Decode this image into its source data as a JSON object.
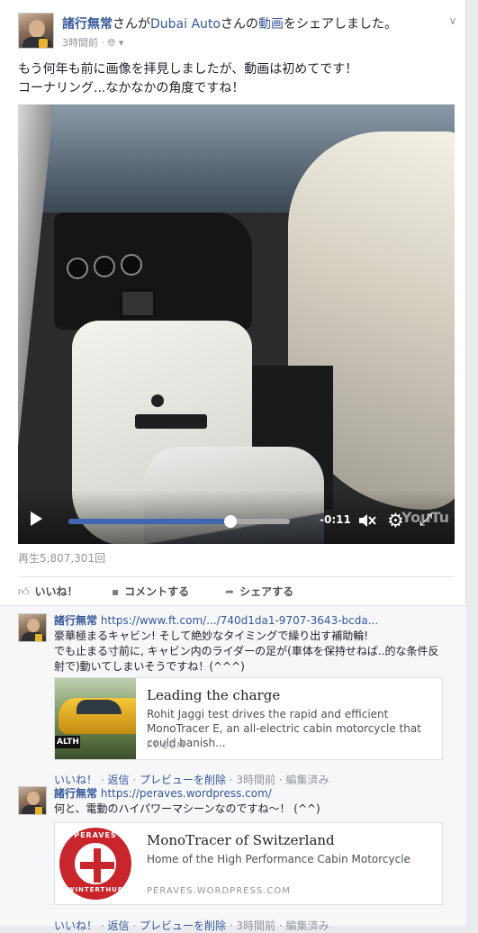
{
  "post": {
    "author": "諸行無常",
    "shared_text_1": "さんが",
    "page_name": "Dubai Auto",
    "shared_text_2": "さんの",
    "video_word": "動画",
    "shared_text_3": "をシェアしました。",
    "time": "3時間前",
    "privacy_icon": "globe-icon",
    "menu_icon": "chevron-down-icon",
    "text_line1": "もう何年も前に画像を拝見しましたが、動画は初めてです！",
    "text_line2": "コーナリング...なかなかの角度ですね！"
  },
  "video": {
    "time_remaining": "-0:11",
    "progress": 0.73,
    "watermark": "YouTu",
    "progress_color": "#4267b2"
  },
  "views": "再生5,807,301回",
  "actions": {
    "like": "いいね！",
    "comment": "コメントする",
    "share": "シェアする"
  },
  "comments": [
    {
      "name": "諸行無常",
      "url": "https://www.ft.com/.../740d1da1-9707-3643-bcda...",
      "text_line1": "豪華極まるキャビン! そして絶妙なタイミングで繰り出す補助輪!",
      "text_line2": "でも止まる寸前に, キャビン内のライダーの足が(車体を保持せねば..的な条件反",
      "text_line3": "射で)動いてしまいそうですね！(^^^)",
      "preview": {
        "title": "Leading the charge",
        "desc": "Rohit Jaggi test drives the rapid and efficient MonoTracer E, an all-electric cabin motorcycle that could banish...",
        "domain": "FT.COM",
        "thumb_label": "ALTH"
      },
      "meta": {
        "like": "いいね！",
        "reply": "返信",
        "remove_preview": "プレビューを削除",
        "time": "3時間前",
        "edited": "編集済み"
      }
    },
    {
      "name": "諸行無常",
      "url": "https://peraves.wordpress.com/",
      "text_line1": "何と、電動のハイパワーマシーンなのですね〜！ (^^)",
      "preview": {
        "title": "MonoTracer of Switzerland",
        "desc": "Home of the High Performance Cabin Motorcycle",
        "domain": "PERAVES.WORDPRESS.COM",
        "logo_top": "PERAVES",
        "logo_bottom": "WINTERTHUR"
      },
      "meta": {
        "like": "いいね！",
        "reply": "返信",
        "remove_preview": "プレビューを削除",
        "time": "3時間前",
        "edited": "編集済み"
      }
    }
  ]
}
